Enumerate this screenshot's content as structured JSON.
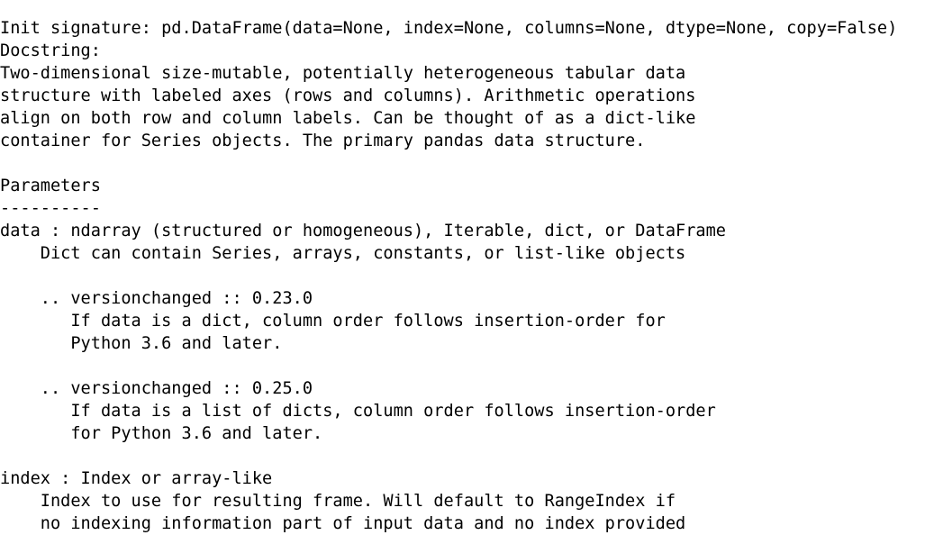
{
  "output": {
    "kind": "python-docstring-help",
    "object": "pd.DataFrame",
    "foreground_color": "#000000",
    "background_color": "#ffffff",
    "lines": [
      "Init signature: pd.DataFrame(data=None, index=None, columns=None, dtype=None, copy=False)",
      "Docstring:",
      "Two-dimensional size-mutable, potentially heterogeneous tabular data",
      "structure with labeled axes (rows and columns). Arithmetic operations",
      "align on both row and column labels. Can be thought of as a dict-like",
      "container for Series objects. The primary pandas data structure.",
      "",
      "Parameters",
      "----------",
      "data : ndarray (structured or homogeneous), Iterable, dict, or DataFrame",
      "    Dict can contain Series, arrays, constants, or list-like objects",
      "",
      "    .. versionchanged :: 0.23.0",
      "       If data is a dict, column order follows insertion-order for",
      "       Python 3.6 and later.",
      "",
      "    .. versionchanged :: 0.25.0",
      "       If data is a list of dicts, column order follows insertion-order",
      "       for Python 3.6 and later.",
      "",
      "index : Index or array-like",
      "    Index to use for resulting frame. Will default to RangeIndex if",
      "    no indexing information part of input data and no index provided"
    ],
    "sections": {
      "init_signature_label": "Init signature:",
      "init_signature_value": "pd.DataFrame(data=None, index=None, columns=None, dtype=None, copy=False)",
      "docstring_label": "Docstring:",
      "parameters_heading": "Parameters",
      "parameters_underline": "----------",
      "parameter_names": [
        "data",
        "index"
      ],
      "version_notes": [
        "0.23.0",
        "0.25.0"
      ]
    }
  }
}
